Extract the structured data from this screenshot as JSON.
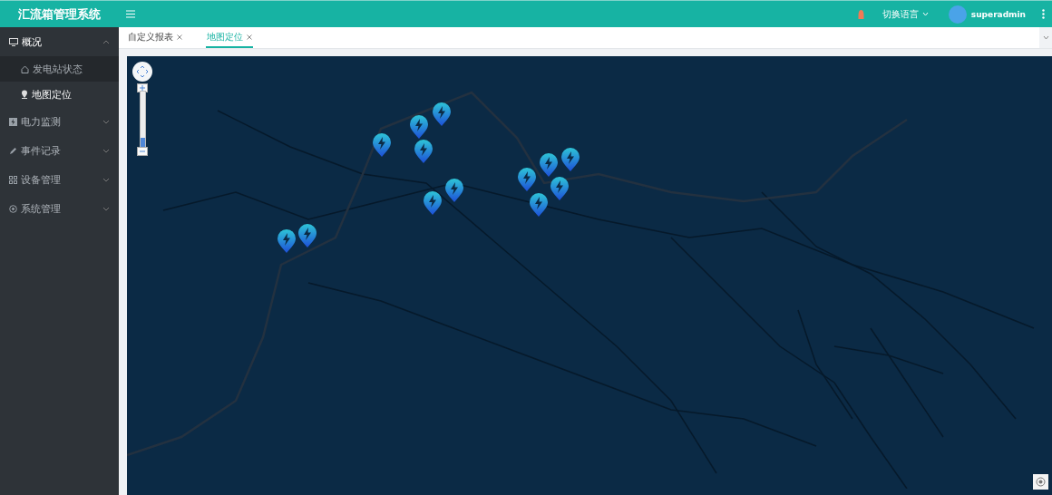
{
  "header": {
    "title": "汇流箱管理系统",
    "language": "切换语言",
    "language_expanded": false,
    "user": "superadmin"
  },
  "sidebar": {
    "items": [
      {
        "label": "概况",
        "expanded": true,
        "children": [
          {
            "label": "发电站状态",
            "selected": false
          },
          {
            "label": "地图定位",
            "selected": true
          }
        ]
      },
      {
        "label": "电力监测",
        "expanded": false
      },
      {
        "label": "事件记录",
        "expanded": false
      },
      {
        "label": "设备管理",
        "expanded": false
      },
      {
        "label": "系统管理",
        "expanded": false
      }
    ]
  },
  "tabs": [
    {
      "label": "自定义报表",
      "selected": false
    },
    {
      "label": "地图定位",
      "selected": true
    }
  ],
  "map": {
    "zoom": {
      "level": 0.2
    }
  }
}
